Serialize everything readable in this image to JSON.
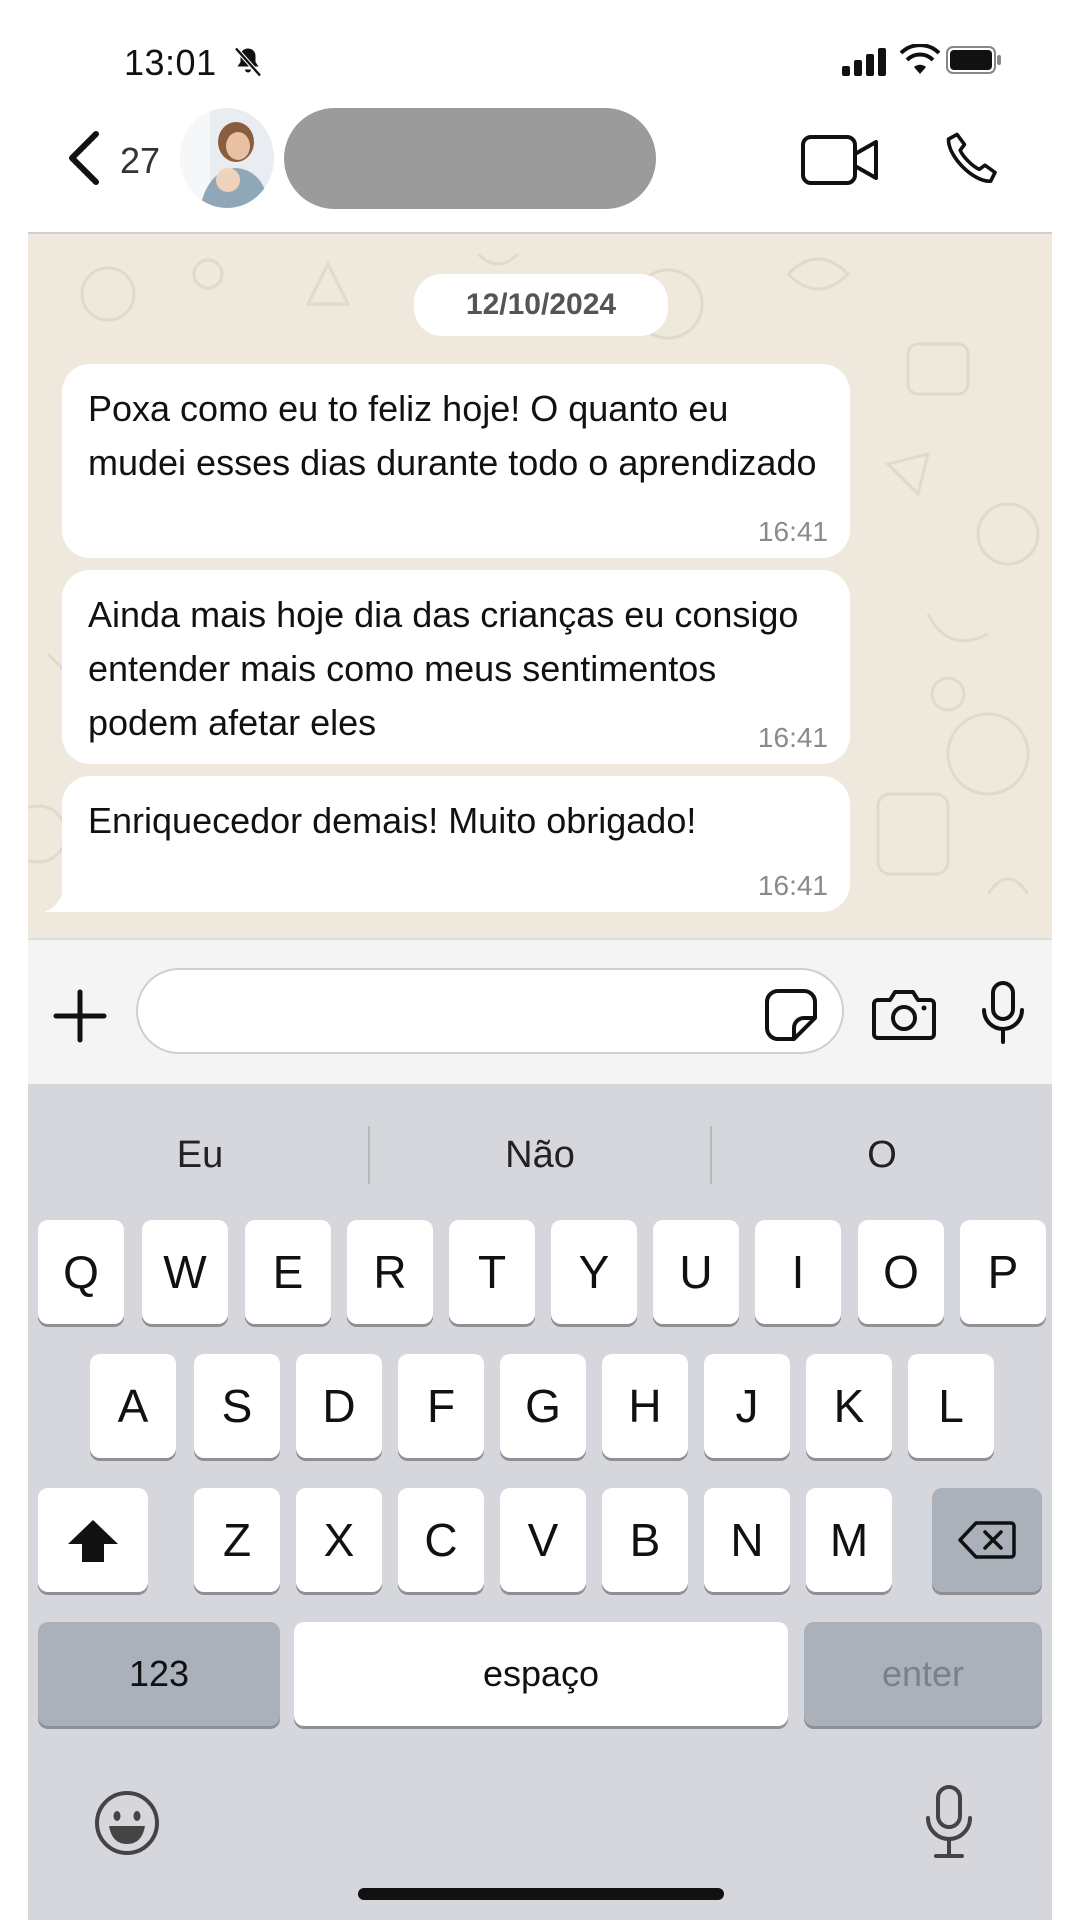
{
  "status_bar": {
    "time": "13:01",
    "icons": [
      "bell-slash-icon",
      "signal-icon",
      "wifi-icon",
      "battery-icon"
    ]
  },
  "header": {
    "unread_count": "27",
    "icons": [
      "chevron-left-icon",
      "avatar",
      "video-camera-icon",
      "phone-icon"
    ]
  },
  "chat": {
    "date_label": "12/10/2024",
    "messages": [
      {
        "text": "Poxa como eu to feliz hoje! O quanto eu mudei esses dias durante todo o aprendizado",
        "time": "16:41"
      },
      {
        "text": "Ainda mais hoje dia das crianças eu consigo entender mais como meus sentimentos podem afetar eles",
        "time": "16:41"
      },
      {
        "text": "Enriquecedor demais! Muito obrigado!",
        "time": "16:41"
      }
    ]
  },
  "composer": {
    "message_value": "",
    "icons": [
      "plus-icon",
      "sticker-icon",
      "camera-icon",
      "microphone-icon"
    ]
  },
  "keyboard": {
    "suggestions": [
      "Eu",
      "Não",
      "O"
    ],
    "row1": [
      "Q",
      "W",
      "E",
      "R",
      "T",
      "Y",
      "U",
      "I",
      "O",
      "P"
    ],
    "row2": [
      "A",
      "S",
      "D",
      "F",
      "G",
      "H",
      "J",
      "K",
      "L"
    ],
    "row3": [
      "Z",
      "X",
      "C",
      "V",
      "B",
      "N",
      "M"
    ],
    "numbers_label": "123",
    "space_label": "espaço",
    "enter_label": "enter",
    "icons": [
      "shift-icon",
      "backspace-icon",
      "emoji-icon",
      "dictation-mic-icon"
    ]
  },
  "colors": {
    "chat_background": "#efe8dc",
    "bubble": "#ffffff",
    "keyboard": "#d6d7dc",
    "special_key": "#abb1ba"
  }
}
